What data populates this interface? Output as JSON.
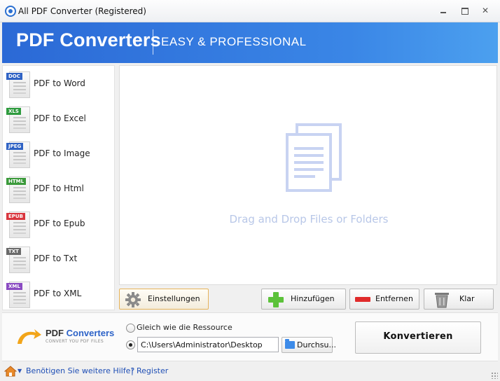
{
  "window": {
    "title": "All PDF Converter (Registered)"
  },
  "banner": {
    "brand": "PDF Converters",
    "tagline": "EASY & PROFESSIONAL"
  },
  "sidebar": {
    "items": [
      {
        "tag": "DOC",
        "tag_color": "#2f62c4",
        "label": "PDF to Word"
      },
      {
        "tag": "XLS",
        "tag_color": "#2e9b3e",
        "label": "PDF to Excel"
      },
      {
        "tag": "JPEG",
        "tag_color": "#2f62c4",
        "label": "PDF to Image"
      },
      {
        "tag": "HTML",
        "tag_color": "#3b9a3b",
        "label": "PDF to Html"
      },
      {
        "tag": "EPUB",
        "tag_color": "#d9363e",
        "label": "PDF to Epub"
      },
      {
        "tag": "TXT",
        "tag_color": "#6a6a6a",
        "label": "PDF to Txt"
      },
      {
        "tag": "XML",
        "tag_color": "#8a4bc2",
        "label": "PDF to XML"
      }
    ]
  },
  "dropzone": {
    "text": "Drag and Drop Files or Folders",
    "icon": "documents-icon"
  },
  "toolbar": {
    "settings_label": "Einstellungen",
    "add_label": "Hinzufügen",
    "remove_label": "Entfernen",
    "clear_label": "Klar"
  },
  "output": {
    "logo_brand_1": "PDF",
    "logo_brand_2": "Converters",
    "logo_sub": "CONVERT YOU PDF FILES",
    "option_same_as_source": "Gleich wie die Ressource",
    "selected_option": "custom-path",
    "path_value": "C:\\Users\\Administrator\\Desktop",
    "browse_label": "Durchsu...",
    "convert_label": "Konvertieren"
  },
  "statusbar": {
    "help_text": "Benötigen Sie weitere Hilfe?",
    "separator": "|",
    "register_text": "Register"
  },
  "colors": {
    "banner_blue": "#2b69d6",
    "accent_link": "#1f4fb5",
    "dropzone_icon": "#c8d3f2",
    "settings_border": "#e6b35a"
  }
}
